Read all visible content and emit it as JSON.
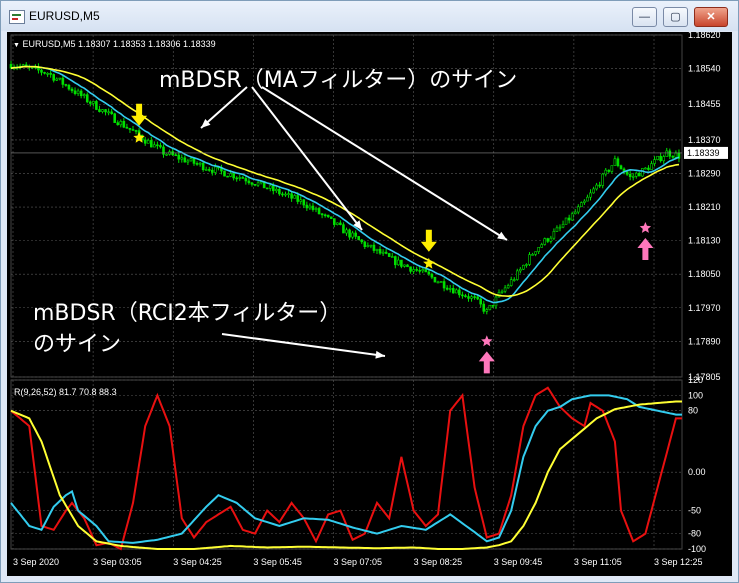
{
  "window": {
    "title": "EURUSD,M5",
    "minimize": "—",
    "maximize": "▢",
    "close": "✕"
  },
  "chart_info": {
    "price_header": "EURUSD,M5  1.18307 1.18353 1.18306 1.18339",
    "indicator_header": "R(9,26,52) 81.7 70.8 88.3"
  },
  "annotations": {
    "ma_filter": "mBDSR（MAフィルター）のサイン",
    "rci_filter_line1": "mBDSR（RCI2本フィルター）",
    "rci_filter_line2": "のサイン"
  },
  "colors": {
    "background": "#000000",
    "bull_candle": "#00e000",
    "bear_candle": "#00e000",
    "ma_fast": "#33ccee",
    "ma_slow": "#ffff33",
    "rci_short": "#e81010",
    "rci_mid": "#33ccee",
    "rci_long": "#ffff33",
    "sell_signal": "#ffee00",
    "buy_signal": "#ff77bb",
    "grid": "#5a5a5a",
    "annotation_text": "#ffffff"
  },
  "chart_data": [
    {
      "type": "candlestick",
      "symbol": "EURUSD",
      "timeframe": "M5",
      "last_price": "1.18339",
      "ylim": [
        1.17805,
        1.1862
      ],
      "y_ticks": [
        "1.18620",
        "1.18540",
        "1.18455",
        "1.18370",
        "1.18290",
        "1.18210",
        "1.18130",
        "1.18050",
        "1.17970",
        "1.17890",
        "1.17805"
      ],
      "price_path": [
        [
          0,
          1.1855
        ],
        [
          12,
          1.1853
        ],
        [
          22,
          1.1848
        ],
        [
          32,
          1.1843
        ],
        [
          42,
          1.1838
        ],
        [
          50,
          1.1834
        ],
        [
          58,
          1.1832
        ],
        [
          66,
          1.183
        ],
        [
          76,
          1.1828
        ],
        [
          86,
          1.1825
        ],
        [
          96,
          1.1822
        ],
        [
          106,
          1.1817
        ],
        [
          116,
          1.1812
        ],
        [
          126,
          1.1808
        ],
        [
          136,
          1.1805
        ],
        [
          146,
          1.1801
        ],
        [
          152,
          1.1799
        ],
        [
          156,
          1.1796
        ],
        [
          160,
          1.18
        ],
        [
          166,
          1.1805
        ],
        [
          172,
          1.1811
        ],
        [
          180,
          1.1816
        ],
        [
          188,
          1.1822
        ],
        [
          194,
          1.1828
        ],
        [
          198,
          1.1832
        ],
        [
          203,
          1.1828
        ],
        [
          208,
          1.183
        ],
        [
          215,
          1.1834
        ],
        [
          220,
          1.1833
        ]
      ],
      "sell_signals": [
        {
          "x": 42,
          "price": 1.18375
        },
        {
          "x": 137,
          "price": 1.18075
        }
      ],
      "buy_signals": [
        {
          "x": 156,
          "price": 1.1789
        },
        {
          "x": 208,
          "price": 1.1816
        }
      ]
    },
    {
      "type": "line",
      "name": "R(9,26,52)",
      "ylim": [
        -100,
        120
      ],
      "y_ticks": [
        "120",
        "100",
        "80",
        "0.00",
        "-50",
        "-80",
        "-100"
      ],
      "x_ticks": [
        "3 Sep 2020",
        "3 Sep 03:05",
        "3 Sep 04:25",
        "3 Sep 05:45",
        "3 Sep 07:05",
        "3 Sep 08:25",
        "3 Sep 09:45",
        "3 Sep 11:05",
        "3 Sep 12:25"
      ],
      "series": [
        {
          "values": [
            [
              0,
              80
            ],
            [
              6,
              60
            ],
            [
              10,
              -70
            ],
            [
              14,
              -75
            ],
            [
              18,
              -50
            ],
            [
              20,
              -40
            ],
            [
              24,
              -60
            ],
            [
              28,
              -95
            ],
            [
              32,
              -92
            ],
            [
              36,
              -100
            ],
            [
              40,
              -40
            ],
            [
              44,
              60
            ],
            [
              48,
              100
            ],
            [
              52,
              60
            ],
            [
              56,
              -60
            ],
            [
              60,
              -85
            ],
            [
              64,
              -65
            ],
            [
              68,
              -55
            ],
            [
              72,
              -45
            ],
            [
              76,
              -75
            ],
            [
              80,
              -80
            ],
            [
              84,
              -50
            ],
            [
              88,
              -65
            ],
            [
              92,
              -40
            ],
            [
              96,
              -60
            ],
            [
              100,
              -90
            ],
            [
              104,
              -55
            ],
            [
              108,
              -50
            ],
            [
              112,
              -88
            ],
            [
              116,
              -80
            ],
            [
              120,
              -40
            ],
            [
              124,
              -60
            ],
            [
              128,
              20
            ],
            [
              132,
              -50
            ],
            [
              136,
              -70
            ],
            [
              140,
              -55
            ],
            [
              144,
              80
            ],
            [
              148,
              100
            ],
            [
              152,
              -20
            ],
            [
              156,
              -85
            ],
            [
              160,
              -80
            ],
            [
              164,
              -30
            ],
            [
              168,
              60
            ],
            [
              172,
              100
            ],
            [
              176,
              110
            ],
            [
              180,
              85
            ],
            [
              184,
              70
            ],
            [
              188,
              60
            ],
            [
              190,
              90
            ],
            [
              194,
              80
            ],
            [
              198,
              40
            ],
            [
              200,
              -50
            ],
            [
              202,
              -70
            ],
            [
              204,
              -90
            ],
            [
              208,
              -80
            ],
            [
              212,
              -20
            ],
            [
              218,
              70
            ]
          ]
        },
        {
          "values": [
            [
              0,
              -40
            ],
            [
              6,
              -70
            ],
            [
              10,
              -75
            ],
            [
              14,
              -45
            ],
            [
              18,
              -30
            ],
            [
              20,
              -25
            ],
            [
              22,
              -50
            ],
            [
              28,
              -70
            ],
            [
              32,
              -90
            ],
            [
              40,
              -92
            ],
            [
              48,
              -88
            ],
            [
              56,
              -80
            ],
            [
              64,
              -45
            ],
            [
              68,
              -30
            ],
            [
              74,
              -40
            ],
            [
              80,
              -60
            ],
            [
              88,
              -70
            ],
            [
              96,
              -60
            ],
            [
              104,
              -62
            ],
            [
              112,
              -72
            ],
            [
              120,
              -80
            ],
            [
              128,
              -70
            ],
            [
              136,
              -75
            ],
            [
              144,
              -55
            ],
            [
              152,
              -78
            ],
            [
              156,
              -90
            ],
            [
              160,
              -85
            ],
            [
              164,
              -50
            ],
            [
              168,
              20
            ],
            [
              172,
              60
            ],
            [
              176,
              80
            ],
            [
              180,
              85
            ],
            [
              184,
              95
            ],
            [
              190,
              100
            ],
            [
              196,
              100
            ],
            [
              202,
              95
            ],
            [
              206,
              85
            ],
            [
              212,
              80
            ],
            [
              218,
              75
            ]
          ]
        },
        {
          "values": [
            [
              0,
              80
            ],
            [
              6,
              70
            ],
            [
              10,
              40
            ],
            [
              16,
              -30
            ],
            [
              22,
              -70
            ],
            [
              28,
              -90
            ],
            [
              36,
              -96
            ],
            [
              48,
              -100
            ],
            [
              60,
              -100
            ],
            [
              72,
              -96
            ],
            [
              84,
              -98
            ],
            [
              96,
              -97
            ],
            [
              108,
              -98
            ],
            [
              120,
              -99
            ],
            [
              132,
              -98
            ],
            [
              140,
              -100
            ],
            [
              148,
              -100
            ],
            [
              156,
              -98
            ],
            [
              160,
              -95
            ],
            [
              164,
              -90
            ],
            [
              168,
              -70
            ],
            [
              172,
              -40
            ],
            [
              176,
              0
            ],
            [
              180,
              30
            ],
            [
              186,
              50
            ],
            [
              192,
              70
            ],
            [
              198,
              82
            ],
            [
              206,
              88
            ],
            [
              212,
              90
            ],
            [
              218,
              92
            ]
          ]
        }
      ]
    }
  ]
}
